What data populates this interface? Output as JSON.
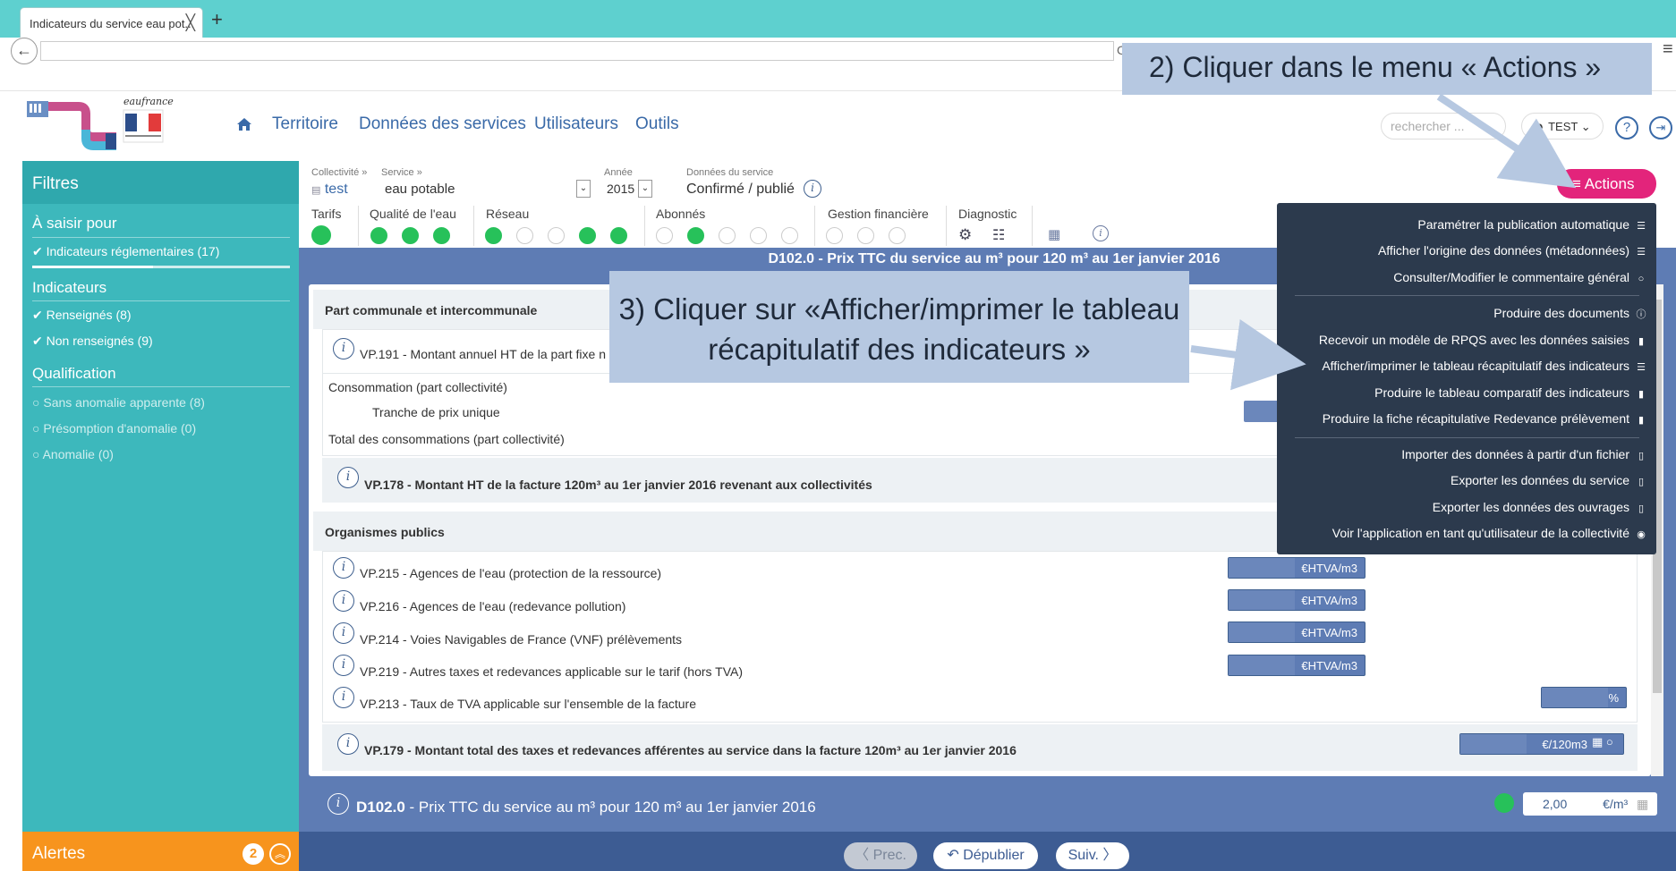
{
  "browser": {
    "tab_title": "Indicateurs du service eau pot...",
    "tab_close": "╳",
    "new_tab": "+",
    "url_glyph": "C",
    "back_glyph": "←",
    "menu_glyph": "≡"
  },
  "header": {
    "logo_text": "eaufrance",
    "nav": [
      "Territoire",
      "Données des services",
      "Utilisateurs",
      "Outils"
    ],
    "search_placeholder": "rechercher ...",
    "user": "TEST",
    "help": "?",
    "logout": "⇥"
  },
  "sidebar": {
    "title": "Filtres",
    "a_saisir": "À saisir pour",
    "reglementaires": "Indicateurs réglementaires (17)",
    "indicateurs": "Indicateurs",
    "renseignes": "Renseignés (8)",
    "non_renseignes": "Non renseignés (9)",
    "qualification": "Qualification",
    "sans_anomalie": "Sans anomalie apparente (8)",
    "presomption": "Présomption d'anomalie (0)",
    "anomalie": "Anomalie (0)",
    "alertes": "Alertes",
    "alert_count": "2",
    "alert_up": "︽"
  },
  "context": {
    "collectivite_label": "Collectivité »",
    "collectivite": "test",
    "service_label": "Service »",
    "service": "eau potable",
    "annee_label": "Année",
    "annee": "2015",
    "donnees_label": "Données du service",
    "donnees": "Confirmé / publié",
    "select_glyph": "⌄"
  },
  "categories": {
    "tarifs": "Tarifs",
    "qualite": "Qualité de l'eau",
    "reseau": "Réseau",
    "abonnes": "Abonnés",
    "gestion": "Gestion financière",
    "diagnostic": "Diagnostic"
  },
  "main": {
    "title": "D102.0 - Prix TTC du service au m³ pour 120 m³ au 1er janvier 2016",
    "part_communale": "Part communale et intercommunale",
    "vp191": "VP.191 - Montant annuel HT de la part fixe n",
    "consommation": "Consommation (part collectivité)",
    "tranche": "Tranche de prix unique",
    "total_conso": "Total des consommations (part collectivité)",
    "vp178": "VP.178 - Montant HT de la facture 120m³ au 1er janvier 2016 revenant aux collectivités",
    "organismes": "Organismes publics",
    "vp215": "VP.215 - Agences de l'eau (protection de la ressource)",
    "vp216": "VP.216 - Agences de l'eau (redevance pollution)",
    "vp214": "VP.214 - Voies Navigables de France (VNF) prélèvements",
    "vp219": "VP.219 - Autres taxes et redevances applicable sur le tarif (hors TVA)",
    "vp213": "VP.213 - Taux de TVA applicable sur l'ensemble de la facture",
    "vp179": "VP.179 - Montant total des taxes et redevances afférentes au service dans la facture 120m³ au 1er janvier 2016",
    "unit_htva": "€HTVA/m3",
    "unit_pct": "%",
    "unit_120": "€/120m3",
    "foot_code": "D102.0",
    "foot_text": " - Prix TTC du service au m³ pour 120 m³ au 1er janvier 2016",
    "foot_value": "2,00",
    "foot_unit": "€/m³",
    "info_glyph": "i"
  },
  "footer_nav": {
    "prev": "Prec.",
    "depublier": "Dépublier",
    "next": "Suiv."
  },
  "actions": {
    "button": "Actions",
    "items": [
      "Paramétrer la publication automatique",
      "Afficher l'origine des données (métadonnées)",
      "Consulter/Modifier le commentaire général",
      "Produire des documents",
      "Recevoir un modèle de RPQS avec les données saisies",
      "Afficher/imprimer le tableau récapitulatif des indicateurs",
      "Produire le tableau comparatif des indicateurs",
      "Produire la fiche récapitulative Redevance prélèvement",
      "Importer des données à partir d'un fichier",
      "Exporter les données du service",
      "Exporter les données des ouvrages",
      "Voir l'application en tant qu'utilisateur de la collectivité"
    ]
  },
  "callouts": {
    "step2": "2) Cliquer dans le menu « Actions »",
    "step3": "3) Cliquer sur «Afficher/imprimer le tableau récapitulatif des indicateurs »"
  },
  "colors": {
    "teal": "#3db8bc",
    "blue": "#5e7cb4",
    "pink": "#e3247b",
    "green": "#27c15a",
    "orange": "#f7941d"
  }
}
